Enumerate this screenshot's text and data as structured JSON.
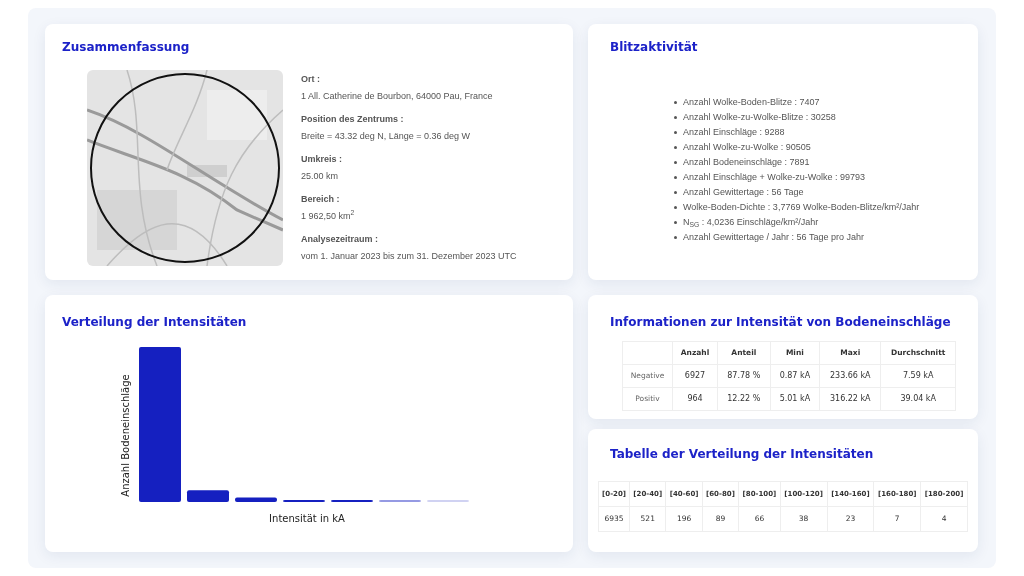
{
  "summary": {
    "title": "Zusammenfassung",
    "fields": [
      {
        "label": "Ort :",
        "value": "1 All. Catherine de Bourbon, 64000 Pau, France"
      },
      {
        "label": "Position des Zentrums :",
        "value": "Breite = 43.32 deg N, Länge = 0.36 deg W"
      },
      {
        "label": "Umkreis :",
        "value": "25.00 km"
      },
      {
        "label": "Bereich :",
        "value": "1 962,50 km$^{2}$"
      },
      {
        "label": "Analysezeitraum :",
        "value": "vom 1. Januar 2023 bis zum 31. Dezember 2023 UTC"
      }
    ]
  },
  "activity": {
    "title": "Blitzaktivität",
    "items": [
      "Anzahl Wolke-Boden-Blitze : 7407",
      "Anzahl Wolke-zu-Wolke-Blitze : 30258",
      "Anzahl Einschläge : 9288",
      "Anzahl Wolke-zu-Wolke : 90505",
      "Anzahl Bodeneinschläge : 7891",
      "Anzahl Einschläge + Wolke-zu-Wolke : 99793",
      "Anzahl Gewittertage : 56 Tage",
      "Wolke-Boden-Dichte : 3,7769 Wolke-Boden-Blitze/km²/Jahr",
      "N$_{SG}$ : 4,0236 Einschläge/km²/Jahr",
      "Anzahl Gewittertage / Jahr : 56 Tage pro Jahr"
    ]
  },
  "distribution_chart": {
    "title": "Verteilung der Intensitäten",
    "ylabel": "Anzahl Bodeneinschläge",
    "xlabel": "Intensität in kA"
  },
  "intensity_info": {
    "title": "Informationen zur Intensität von Bodeneinschläge",
    "columns": [
      "Anzahl",
      "Anteil",
      "Mini",
      "Maxi",
      "Durchschnitt"
    ],
    "rows": [
      {
        "label": "Negative",
        "cells": [
          "6927",
          "87.78 %",
          "0.87 kA",
          "233.66 kA",
          "7.59 kA"
        ]
      },
      {
        "label": "Positiv",
        "cells": [
          "964",
          "12.22 %",
          "5.01 kA",
          "316.22 kA",
          "39.04 kA"
        ]
      }
    ]
  },
  "distribution_table": {
    "title": "Tabelle der Verteilung der Intensitäten",
    "columns": [
      "[0-20]",
      "[20-40]",
      "[40-60]",
      "[60-80]",
      "[80-100]",
      "[100-120]",
      "[140-160]",
      "[160-180]",
      "[180-200]"
    ],
    "values": [
      "6935",
      "521",
      "196",
      "89",
      "66",
      "38",
      "23",
      "7",
      "4"
    ]
  }
}
